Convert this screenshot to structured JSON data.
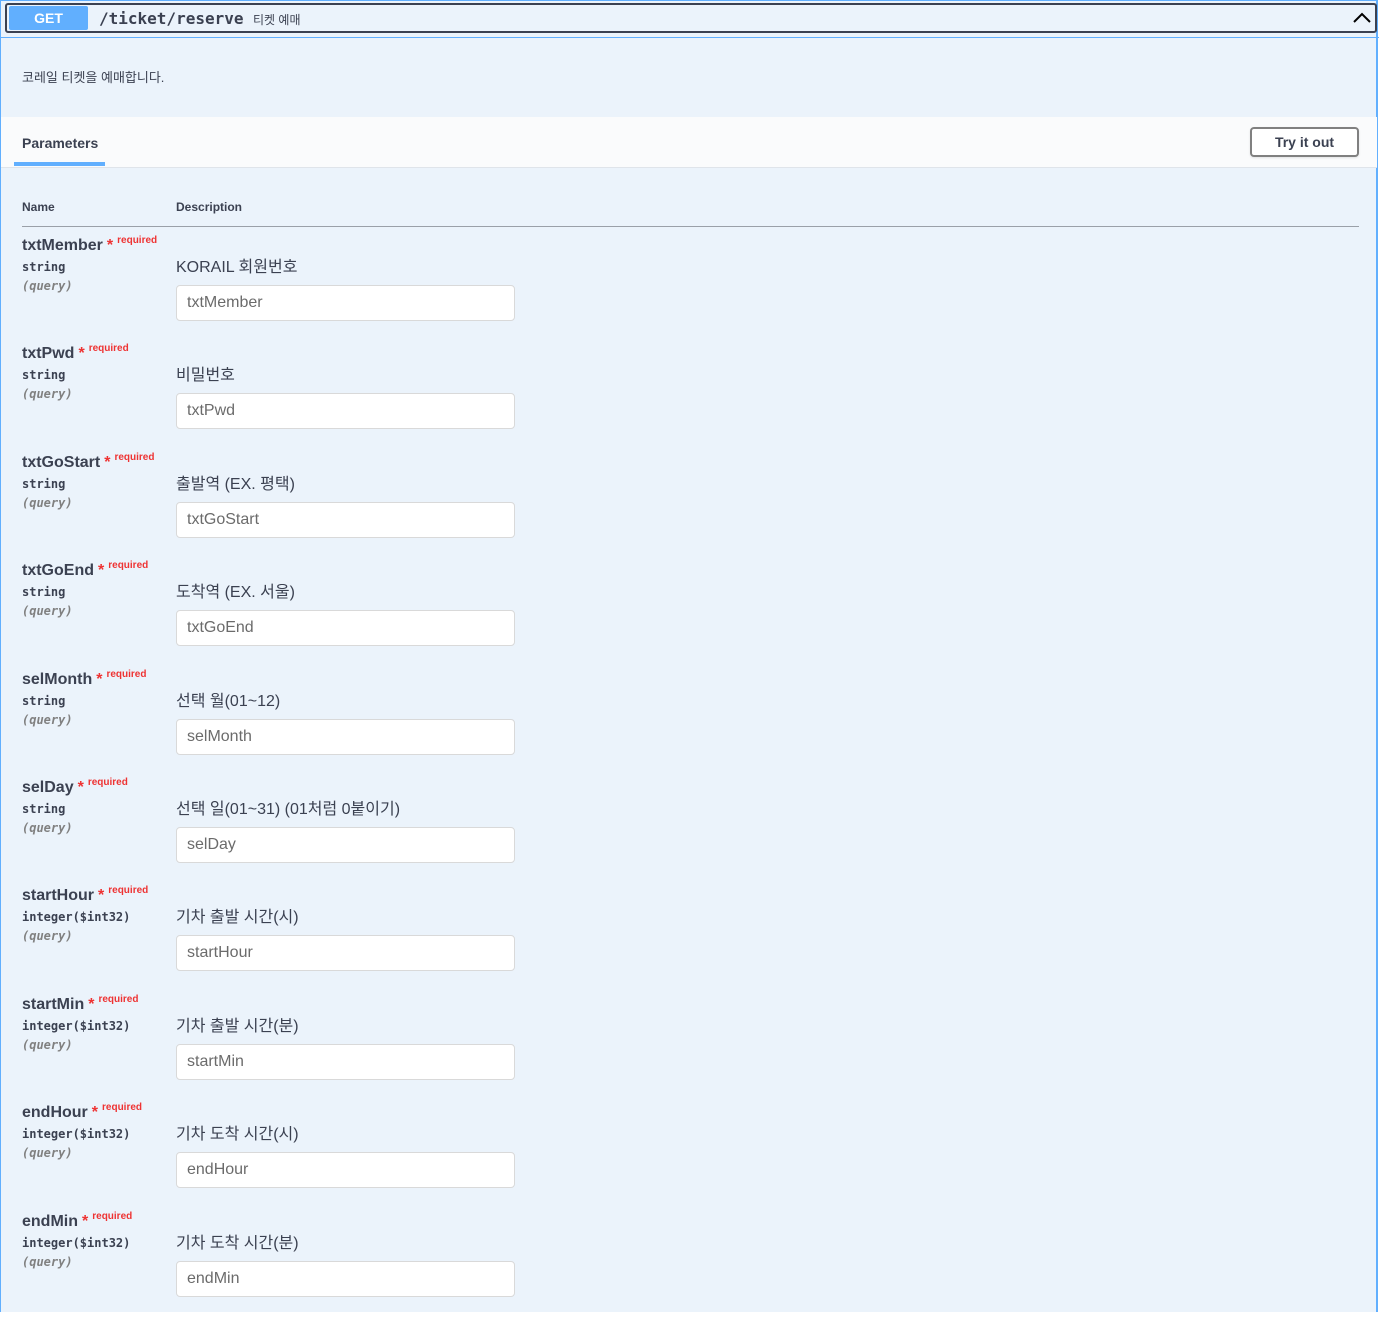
{
  "operation": {
    "method": "GET",
    "path": "/ticket/reserve",
    "summary": "티켓 예매",
    "description": "코레일 티켓을 예매합니다."
  },
  "section": {
    "tab_label": "Parameters",
    "try_button_label": "Try it out"
  },
  "table": {
    "col_name": "Name",
    "col_description": "Description"
  },
  "required_mark": "*",
  "required_label": "required",
  "parameters": [
    {
      "name": "txtMember",
      "type": "string",
      "in": "(query)",
      "description": "KORAIL 회원번호",
      "placeholder": "txtMember"
    },
    {
      "name": "txtPwd",
      "type": "string",
      "in": "(query)",
      "description": "비밀번호",
      "placeholder": "txtPwd"
    },
    {
      "name": "txtGoStart",
      "type": "string",
      "in": "(query)",
      "description": "출발역 (EX. 평택)",
      "placeholder": "txtGoStart"
    },
    {
      "name": "txtGoEnd",
      "type": "string",
      "in": "(query)",
      "description": "도착역 (EX. 서울)",
      "placeholder": "txtGoEnd"
    },
    {
      "name": "selMonth",
      "type": "string",
      "in": "(query)",
      "description": "선택 월(01~12)",
      "placeholder": "selMonth"
    },
    {
      "name": "selDay",
      "type": "string",
      "in": "(query)",
      "description": "선택 일(01~31) (01처럼 0붙이기)",
      "placeholder": "selDay"
    },
    {
      "name": "startHour",
      "type": "integer($int32)",
      "in": "(query)",
      "description": "기차 출발 시간(시)",
      "placeholder": "startHour"
    },
    {
      "name": "startMin",
      "type": "integer($int32)",
      "in": "(query)",
      "description": "기차 출발 시간(분)",
      "placeholder": "startMin"
    },
    {
      "name": "endHour",
      "type": "integer($int32)",
      "in": "(query)",
      "description": "기차 도착 시간(시)",
      "placeholder": "endHour"
    },
    {
      "name": "endMin",
      "type": "integer($int32)",
      "in": "(query)",
      "description": "기차 도착 시간(분)",
      "placeholder": "endMin"
    }
  ],
  "colors": {
    "get_method": "#61affe",
    "required": "#ee3333",
    "text": "#3b4151",
    "block_background": "#ebf3fb"
  }
}
